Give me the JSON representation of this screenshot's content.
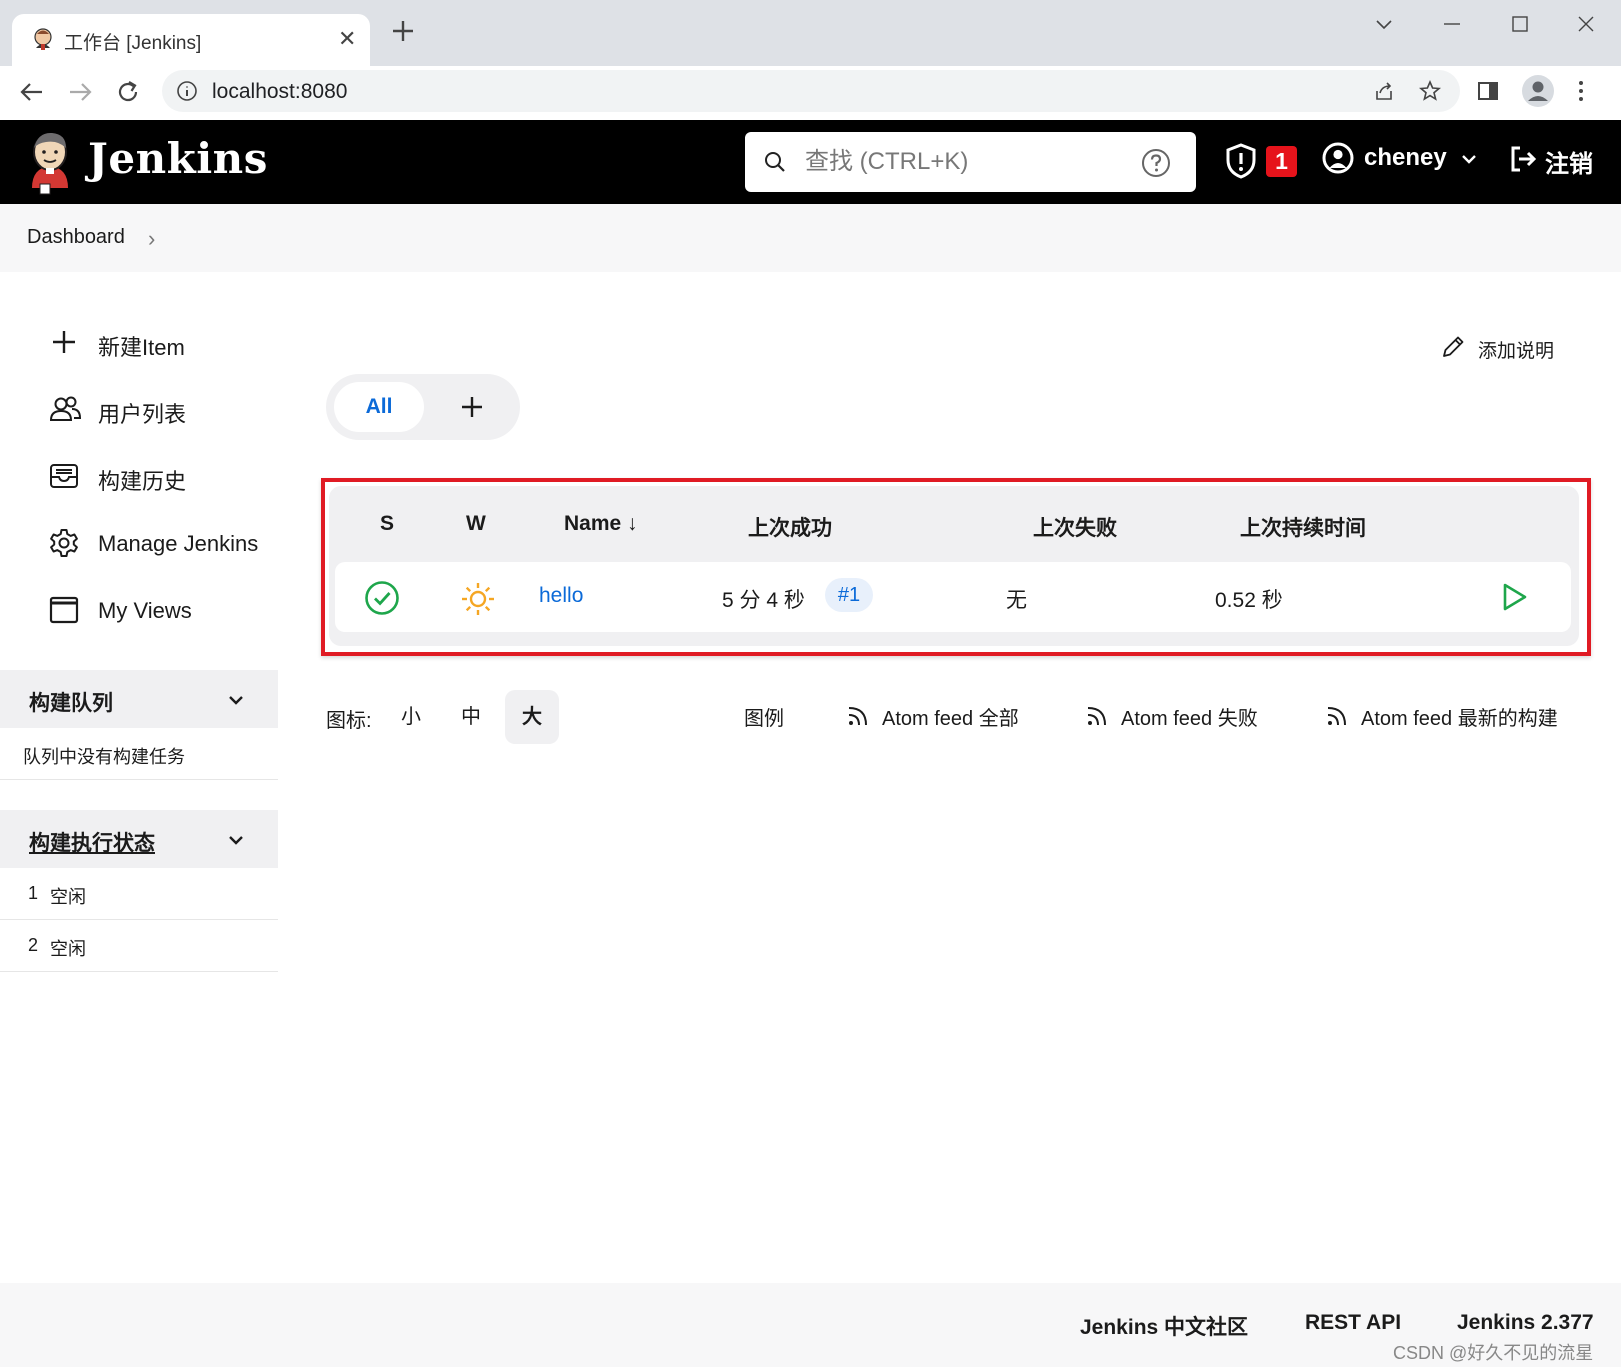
{
  "browser": {
    "tab_title": "工作台 [Jenkins]",
    "close_glyph": "✕",
    "url": "localhost:8080"
  },
  "header": {
    "logo_text": "Jenkins",
    "search_placeholder": "查找 (CTRL+K)",
    "security_count": "1",
    "username": "cheney",
    "logout_label": "注销"
  },
  "breadcrumb": {
    "item": "Dashboard",
    "separator": "›"
  },
  "sidebar": {
    "items": [
      {
        "label": "新建Item",
        "icon": "plus-icon"
      },
      {
        "label": "用户列表",
        "icon": "users-icon"
      },
      {
        "label": "构建历史",
        "icon": "history-icon"
      },
      {
        "label": "Manage Jenkins",
        "icon": "gear-icon"
      },
      {
        "label": "My Views",
        "icon": "window-icon"
      }
    ],
    "build_queue": {
      "title": "构建队列",
      "empty_text": "队列中没有构建任务"
    },
    "executor_status": {
      "title": "构建执行状态",
      "executors": [
        {
          "number": "1",
          "status": "空闲"
        },
        {
          "number": "2",
          "status": "空闲"
        }
      ]
    }
  },
  "main": {
    "add_description": "添加说明",
    "view_tabs": {
      "active": "All"
    },
    "table": {
      "headers": {
        "s": "S",
        "w": "W",
        "name": "Name ↓",
        "last_success": "上次成功",
        "last_failure": "上次失败",
        "last_duration": "上次持续时间"
      },
      "rows": [
        {
          "status": "success",
          "weather": "sunny",
          "name": "hello",
          "last_success": "5 分 4 秒",
          "build": "#1",
          "last_failure": "无",
          "last_duration": "0.52 秒"
        }
      ]
    },
    "icon_size": {
      "label": "图标:",
      "options": [
        "小",
        "中",
        "大"
      ],
      "selected": "大"
    },
    "legend": "图例",
    "feeds": [
      "Atom feed 全部",
      "Atom feed 失败",
      "Atom feed 最新的构建"
    ]
  },
  "footer": {
    "links": [
      "Jenkins 中文社区",
      "REST API",
      "Jenkins 2.377"
    ],
    "watermark": "CSDN @好久不见的流星"
  },
  "colors": {
    "accent": "#0b6ad8",
    "success": "#1ea64b",
    "sunny": "#f5a623",
    "highlight": "#e01b24",
    "badge": "#e6131b"
  }
}
